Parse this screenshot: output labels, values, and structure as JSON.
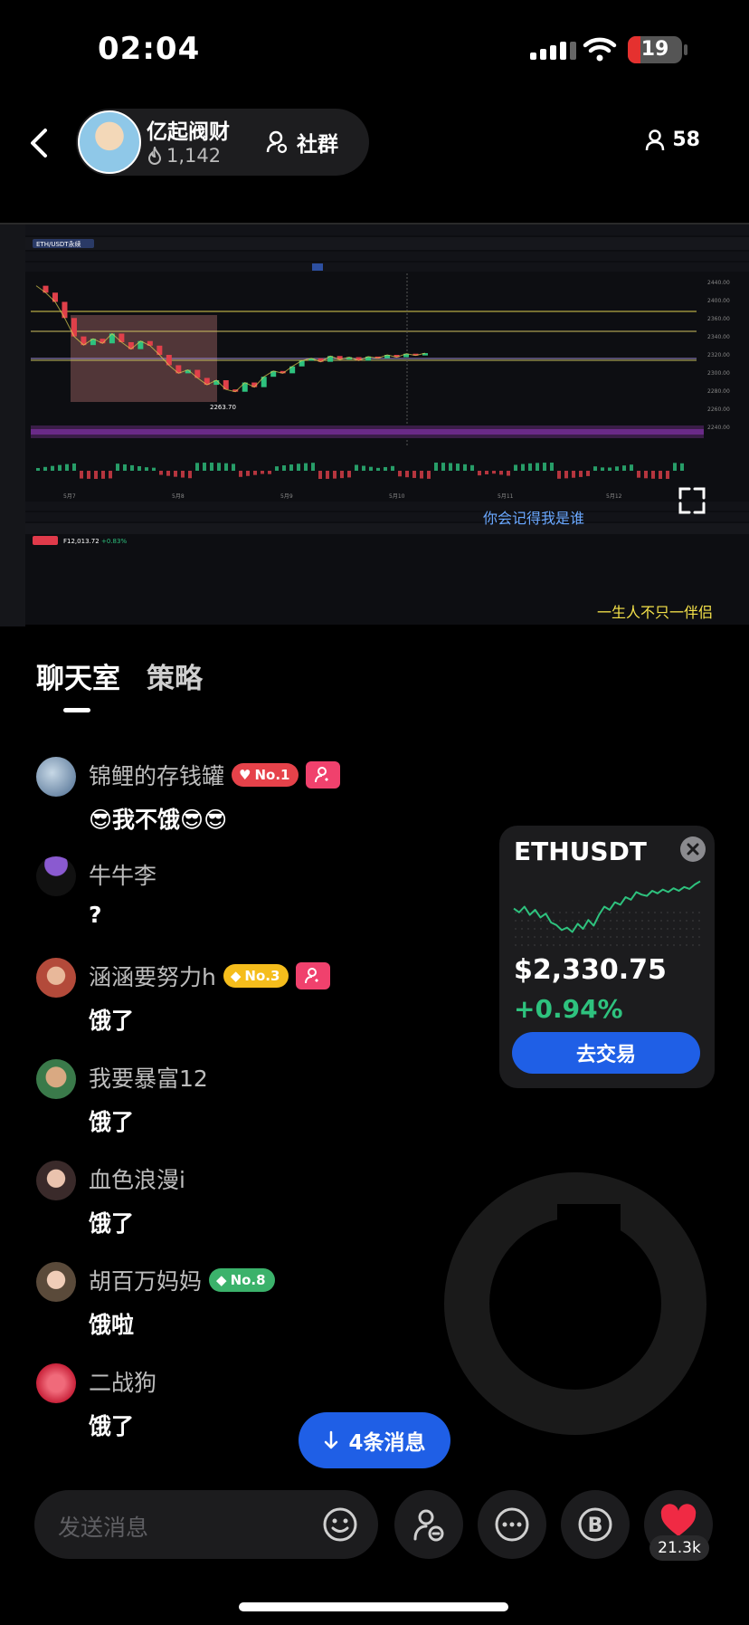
{
  "status_bar": {
    "time": "02:04",
    "battery": "19"
  },
  "header": {
    "host_name": "亿起阀财",
    "host_likes": "1,142",
    "group_label": "社群",
    "viewer_count": "58"
  },
  "stream": {
    "symbol_tab": "ETH/USDT永续",
    "subtitle_1": "你会记得我是谁",
    "subtitle_2": "一生人不只一伴侣",
    "axis_labels": [
      "5月7",
      "5月8",
      "5月9",
      "5月10",
      "5月11",
      "5月12"
    ],
    "price_labels": [
      "2440.00",
      "2400.00",
      "2360.00",
      "2340.00",
      "2320.00",
      "2300.00",
      "2280.00",
      "2260.00",
      "2240.00"
    ],
    "low_marker": "2263.70",
    "bottom_ticker": "F12,013.72",
    "bottom_ticker_change": "+0.83%",
    "chart_data": {
      "type": "line",
      "title": "",
      "series": [
        {
          "values": [
            2448,
            2436,
            2420,
            2392,
            2360,
            2345,
            2356,
            2348,
            2365,
            2350,
            2338,
            2352,
            2344,
            2328,
            2310,
            2296,
            2302,
            2288,
            2276,
            2284,
            2268,
            2264,
            2280,
            2272,
            2290,
            2300,
            2296,
            2308,
            2318,
            2322,
            2316,
            2326,
            2320,
            2324,
            2318,
            2325,
            2322,
            2328,
            2324,
            2330,
            2327,
            2331
          ]
        }
      ],
      "ylim": [
        2240,
        2460
      ]
    }
  },
  "tabs": {
    "chat": "聊天室",
    "strategy": "策略"
  },
  "messages": [
    {
      "user": "锦鲤的存钱罐",
      "badge": "No.1",
      "text": "😎我不饿😎😎"
    },
    {
      "user": "牛牛李",
      "badge": "",
      "text": "?"
    },
    {
      "user": "涵涵要努力h",
      "badge": "No.3",
      "text": "饿了"
    },
    {
      "user": "我要暴富12",
      "badge": "",
      "text": "饿了"
    },
    {
      "user": "血色浪漫i",
      "badge": "",
      "text": "饿了"
    },
    {
      "user": "胡百万妈妈",
      "badge": "No.8",
      "text": "饿啦"
    },
    {
      "user": "二战狗",
      "badge": "",
      "text": "饿了"
    }
  ],
  "ticker_card": {
    "symbol": "ETHUSDT",
    "price": "$2,330.75",
    "change": "+0.94%",
    "trade_label": "去交易",
    "spark": [
      0.52,
      0.46,
      0.55,
      0.42,
      0.5,
      0.38,
      0.44,
      0.3,
      0.26,
      0.18,
      0.22,
      0.15,
      0.28,
      0.2,
      0.34,
      0.25,
      0.42,
      0.55,
      0.5,
      0.62,
      0.58,
      0.7,
      0.66,
      0.78,
      0.74,
      0.72,
      0.8,
      0.76,
      0.82,
      0.78,
      0.84,
      0.8,
      0.86,
      0.83,
      0.9,
      0.95
    ]
  },
  "new_messages": {
    "label": "4条消息"
  },
  "composer": {
    "placeholder": "发送消息",
    "like_count": "21.3k"
  },
  "colors": {
    "accent_blue": "#1f5fe6",
    "up_green": "#2ec27e",
    "badge_red": "#e6424a",
    "badge_gold": "#f5bd1c",
    "badge_green": "#3bb26b"
  }
}
